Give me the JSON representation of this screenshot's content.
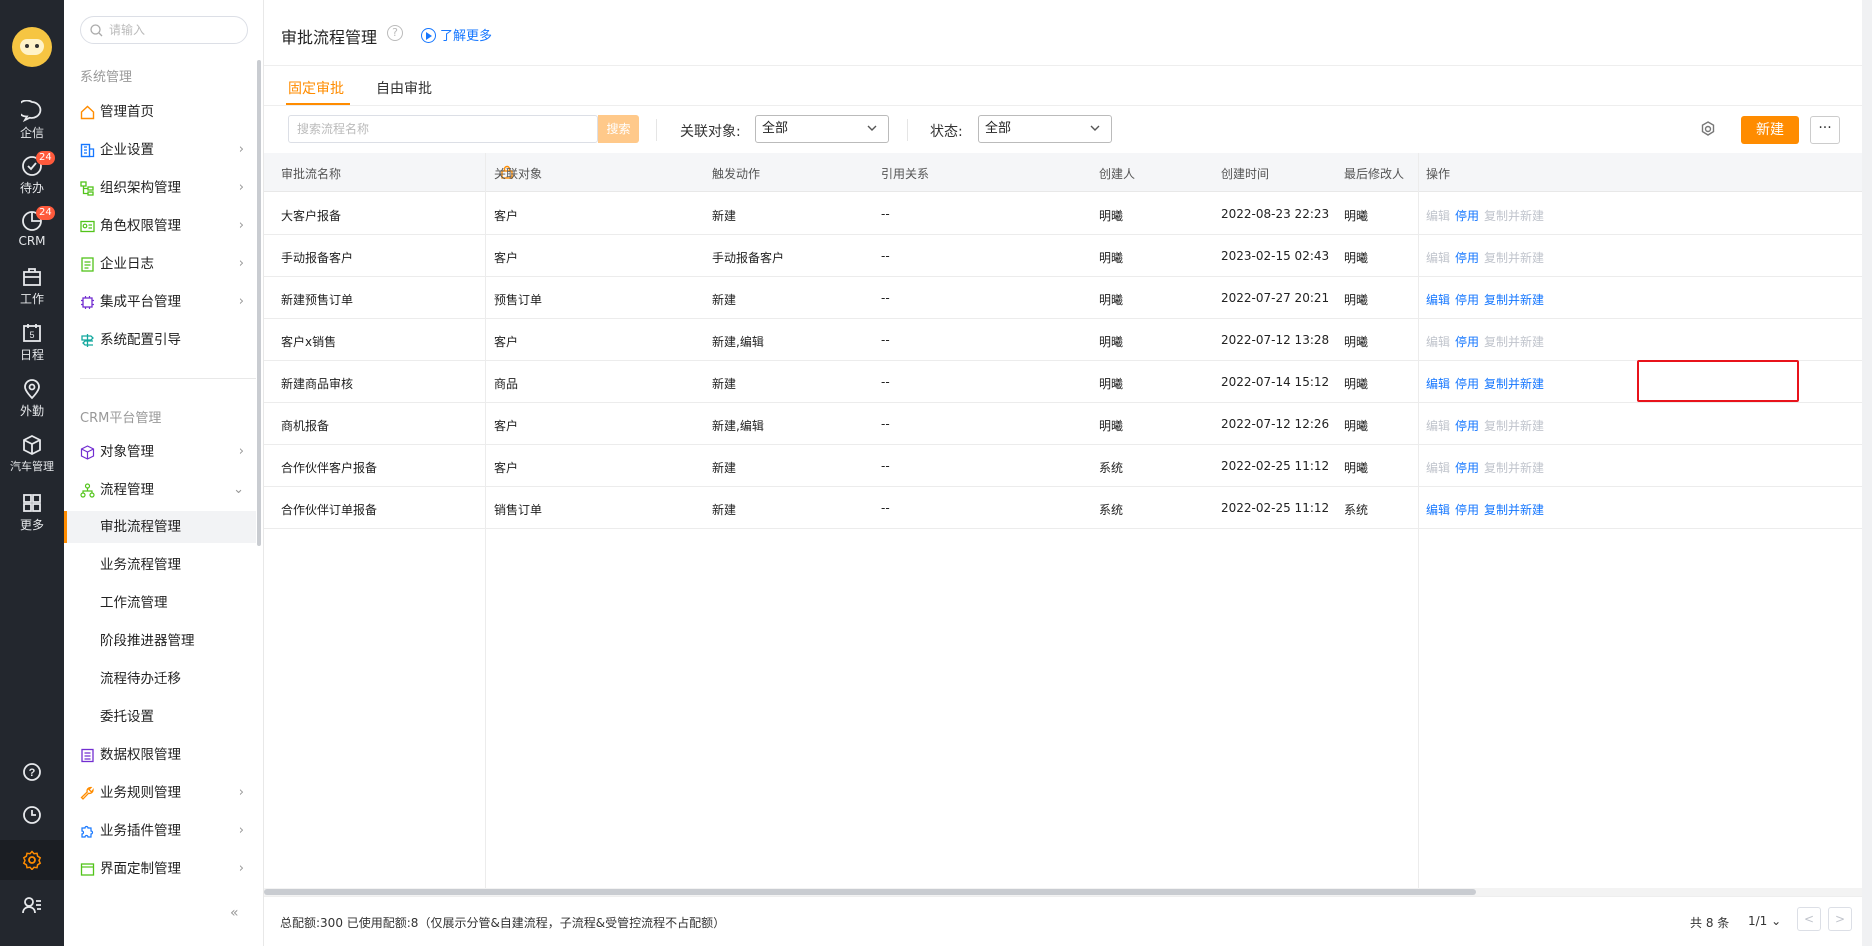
{
  "rail": {
    "items": [
      {
        "label": "企信",
        "icon": "chat-icon"
      },
      {
        "label": "待办",
        "icon": "todo-check-icon",
        "badge": "24"
      },
      {
        "label": "CRM",
        "icon": "crm-pie-icon",
        "badge": "24"
      },
      {
        "label": "工作",
        "icon": "briefcase-icon"
      },
      {
        "label": "日程",
        "icon": "calendar-icon",
        "day": "5"
      },
      {
        "label": "外勤",
        "icon": "location-pin-icon"
      },
      {
        "label": "汽车管理",
        "icon": "cube-icon"
      },
      {
        "label": "更多",
        "icon": "grid-icon"
      }
    ]
  },
  "sidebar": {
    "search_placeholder": "请输入",
    "section1": "系统管理",
    "section2": "CRM平台管理",
    "items": [
      {
        "label": "管理首页"
      },
      {
        "label": "企业设置"
      },
      {
        "label": "组织架构管理"
      },
      {
        "label": "角色权限管理"
      },
      {
        "label": "企业日志"
      },
      {
        "label": "集成平台管理"
      },
      {
        "label": "系统配置引导"
      },
      {
        "label": "对象管理"
      },
      {
        "label": "流程管理"
      },
      {
        "label": "数据权限管理"
      },
      {
        "label": "业务规则管理"
      },
      {
        "label": "业务插件管理"
      },
      {
        "label": "界面定制管理"
      }
    ],
    "subitems": [
      {
        "label": "审批流程管理"
      },
      {
        "label": "业务流程管理"
      },
      {
        "label": "工作流管理"
      },
      {
        "label": "阶段推进器管理"
      },
      {
        "label": "流程待办迁移"
      },
      {
        "label": "委托设置"
      }
    ],
    "collapse": "«"
  },
  "header": {
    "title": "审批流程管理",
    "help": "?",
    "learn_more": "了解更多"
  },
  "tabs": [
    {
      "label": "固定审批"
    },
    {
      "label": "自由审批"
    }
  ],
  "filters": {
    "search_placeholder": "搜索流程名称",
    "search_button": "搜索",
    "object_label": "关联对象:",
    "object_value": "全部",
    "status_label": "状态:",
    "status_value": "全部",
    "new_button": "新建",
    "more_button": "···"
  },
  "table": {
    "columns": [
      "审批流名称",
      "关联对象",
      "触发动作",
      "引用关系",
      "创建人",
      "创建时间",
      "最后修改人",
      "操作"
    ],
    "rows": [
      {
        "name": "大客户报备",
        "object": "客户",
        "trigger": "新建",
        "ref": "--",
        "creator": "明曦",
        "created": "2022-08-23 22:23",
        "modifier": "明曦",
        "edit_enabled": false,
        "copy_enabled": false
      },
      {
        "name": "手动报备客户",
        "object": "客户",
        "trigger": "手动报备客户",
        "ref": "--",
        "creator": "明曦",
        "created": "2023-02-15 02:43",
        "modifier": "明曦",
        "edit_enabled": false,
        "copy_enabled": false
      },
      {
        "name": "新建预售订单",
        "object": "预售订单",
        "trigger": "新建",
        "ref": "--",
        "creator": "明曦",
        "created": "2022-07-27 20:21",
        "modifier": "明曦",
        "edit_enabled": true,
        "copy_enabled": true
      },
      {
        "name": "客户x销售",
        "object": "客户",
        "trigger": "新建,编辑",
        "ref": "--",
        "creator": "明曦",
        "created": "2022-07-12 13:28",
        "modifier": "明曦",
        "edit_enabled": false,
        "copy_enabled": false
      },
      {
        "name": "新建商品审核",
        "object": "商品",
        "trigger": "新建",
        "ref": "--",
        "creator": "明曦",
        "created": "2022-07-14 15:12",
        "modifier": "明曦",
        "edit_enabled": true,
        "copy_enabled": true
      },
      {
        "name": "商机报备",
        "object": "客户",
        "trigger": "新建,编辑",
        "ref": "--",
        "creator": "明曦",
        "created": "2022-07-12 12:26",
        "modifier": "明曦",
        "edit_enabled": false,
        "copy_enabled": false
      },
      {
        "name": "合作伙伴客户报备",
        "object": "客户",
        "trigger": "新建",
        "ref": "--",
        "creator": "系统",
        "created": "2022-02-25 11:12",
        "modifier": "明曦",
        "edit_enabled": false,
        "copy_enabled": false
      },
      {
        "name": "合作伙伴订单报备",
        "object": "销售订单",
        "trigger": "新建",
        "ref": "--",
        "creator": "系统",
        "created": "2022-02-25 11:12",
        "modifier": "系统",
        "edit_enabled": true,
        "copy_enabled": true
      }
    ],
    "action_labels": {
      "edit": "编辑",
      "disable": "停用",
      "copy": "复制并新建"
    }
  },
  "footer": {
    "quota_text": "总配额:300 已使用配额:8（仅展示分管&自建流程，子流程&受管控流程不占配额）",
    "total": "共 8 条",
    "page": "1/1",
    "prev": "<",
    "next": ">"
  },
  "colors": {
    "accent": "#ff8c00",
    "link": "#1677ff",
    "highlight": "#e8131b",
    "rail": "#23272e"
  }
}
